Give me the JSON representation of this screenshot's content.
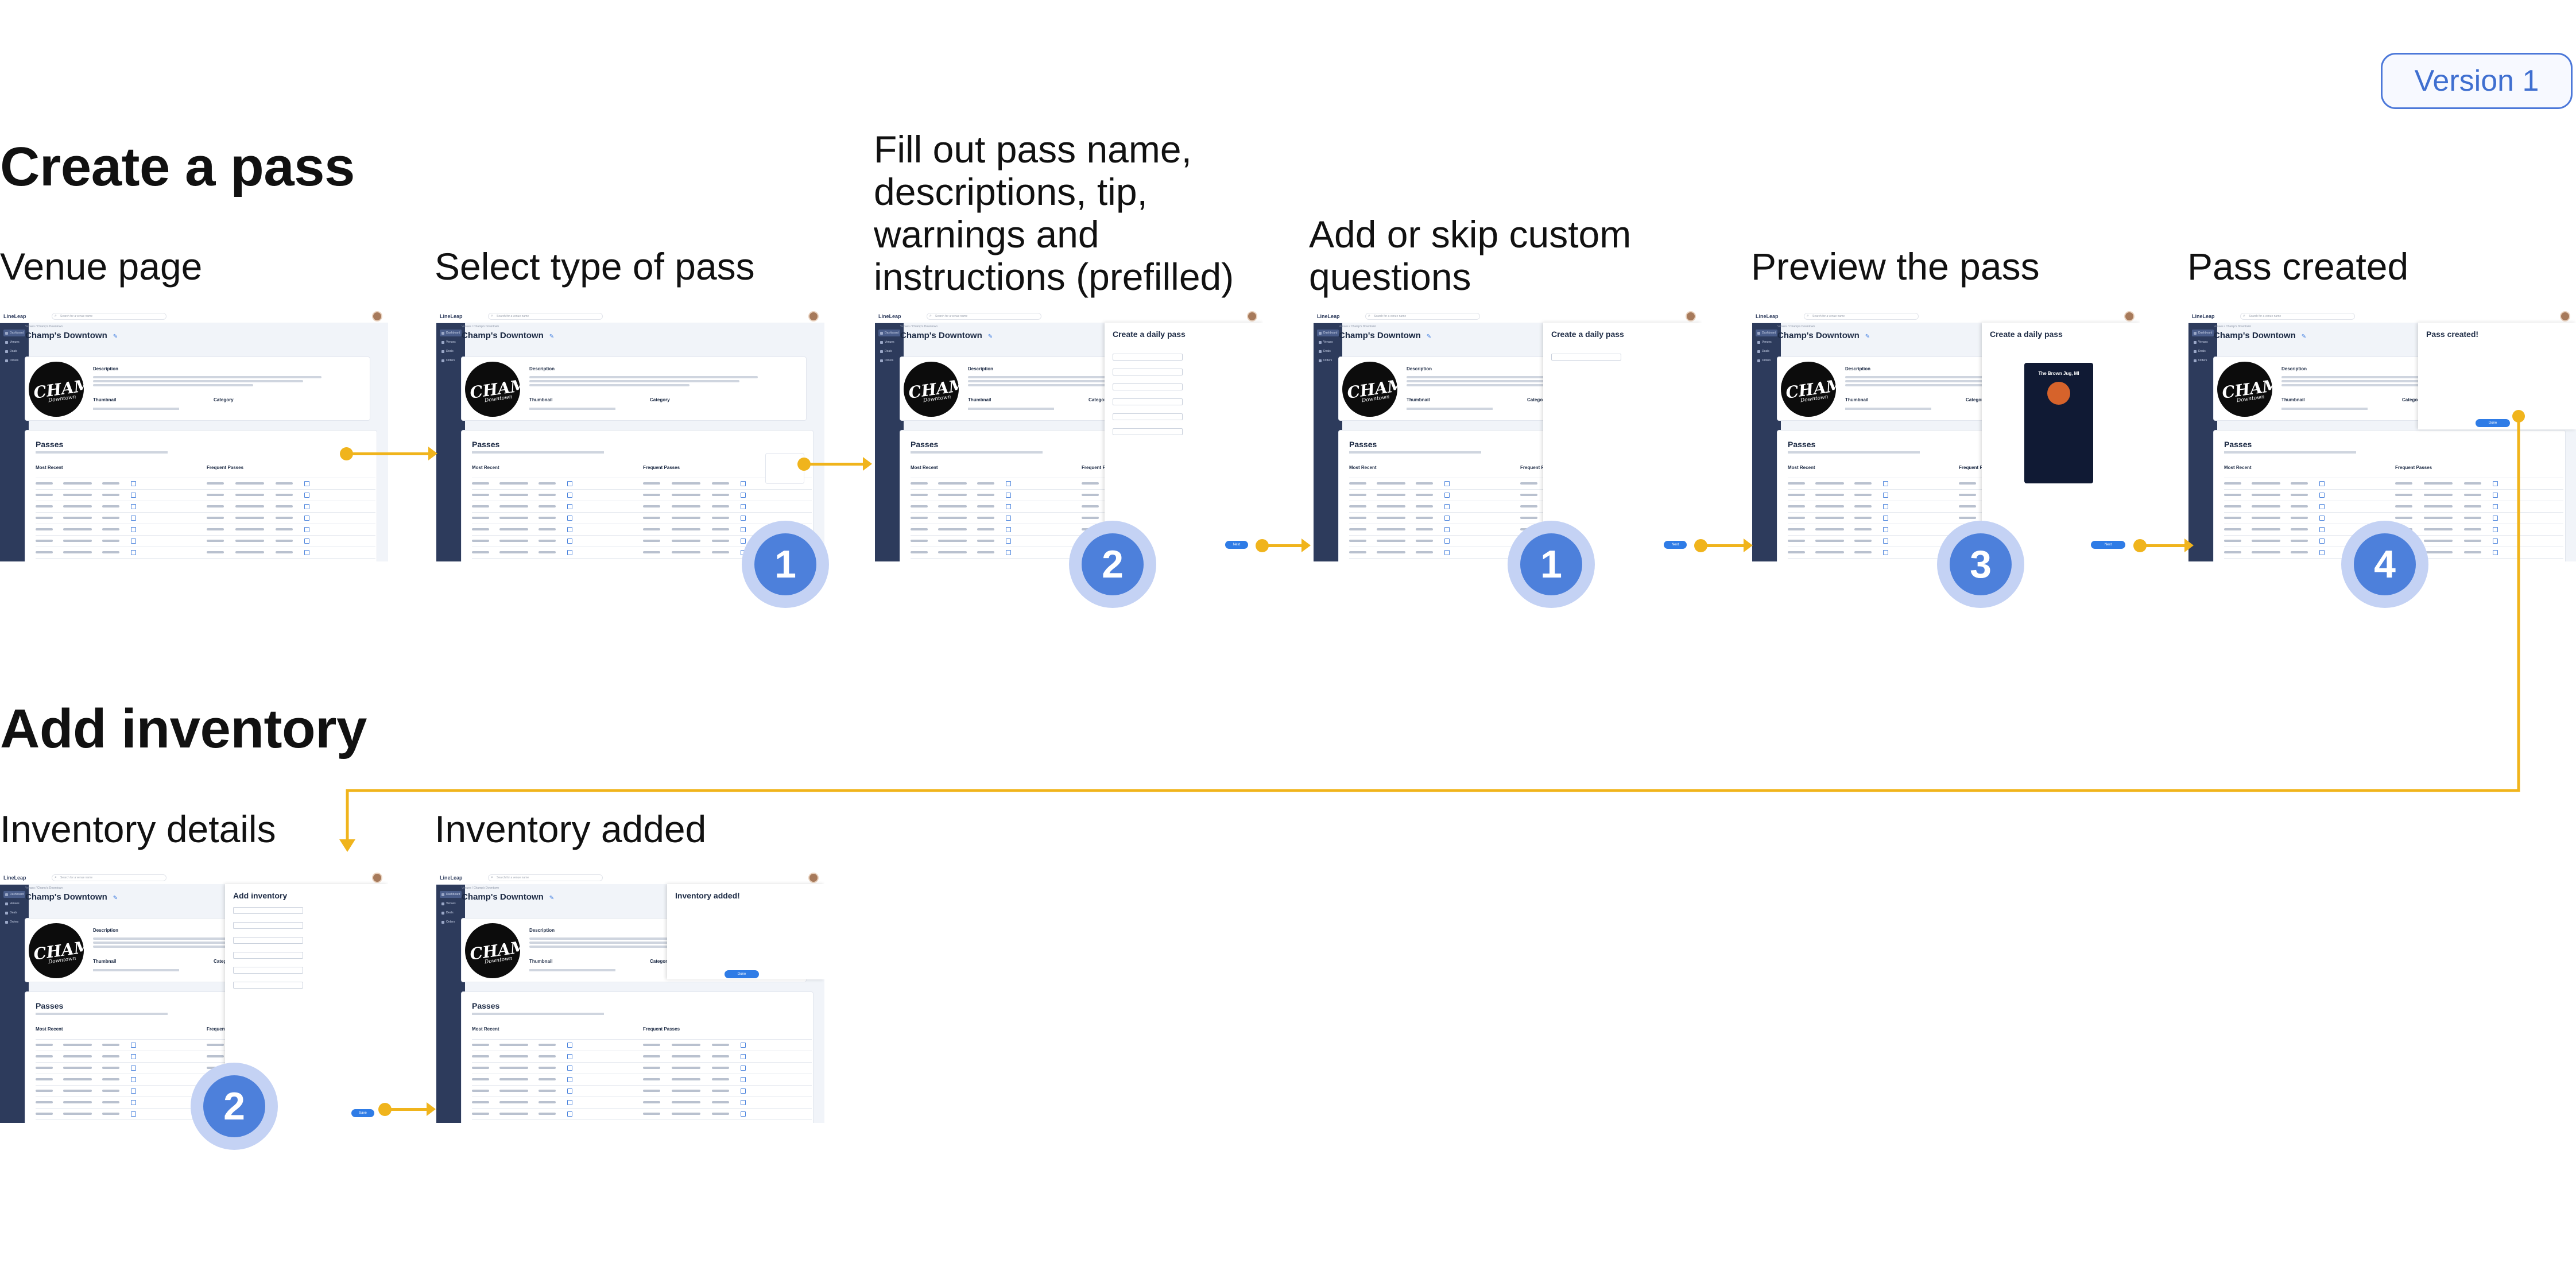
{
  "version_label": "Version 1",
  "sections": {
    "create": "Create a pass",
    "inventory": "Add inventory"
  },
  "steps": {
    "venue_page": "Venue page",
    "select_type": "Select type of pass",
    "fill_out": [
      "Fill out pass name,",
      "descriptions, tip,",
      "warnings and",
      "instructions (prefilled)"
    ],
    "custom_q": [
      "Add or skip custom",
      "questions"
    ],
    "preview": "Preview the pass",
    "created": "Pass created",
    "inv_details": "Inventory details",
    "inv_added": "Inventory added"
  },
  "badges": [
    "1",
    "2",
    "1",
    "3",
    "4",
    "2"
  ],
  "screen": {
    "app_name": "LineLeap",
    "search_placeholder": "Search for a venue name",
    "breadcrumb": "Venues / Champ's Downtown",
    "venue_title": "Champ's Downtown",
    "description_label": "Description",
    "thumbnail_label": "Thumbnail",
    "category_label": "Category",
    "passes_title": "Passes",
    "most_recent": "Most Recent",
    "frequent_passes": "Frequent Passes",
    "sidebar": [
      "Dashboard",
      "Venues",
      "Deals",
      "Orders"
    ],
    "logo_text": "CHAMPS",
    "logo_sub": "Downtown",
    "overlay_daily_pass": "Create a daily pass",
    "overlay_pass_created": "Pass created!",
    "overlay_add_inventory": "Add inventory",
    "overlay_inventory_added": "Inventory added!",
    "preview_card_title": "The Brown Jug, MI",
    "next_label": "Next",
    "save_label": "Save",
    "done_label": "Done"
  },
  "accent_colors": {
    "arrow": "#f0b41c",
    "badge": "#4d80db",
    "badge_halo": "#c4d2f4",
    "sidebar": "#2d3b5c",
    "primary_button": "#2f7ce6"
  }
}
